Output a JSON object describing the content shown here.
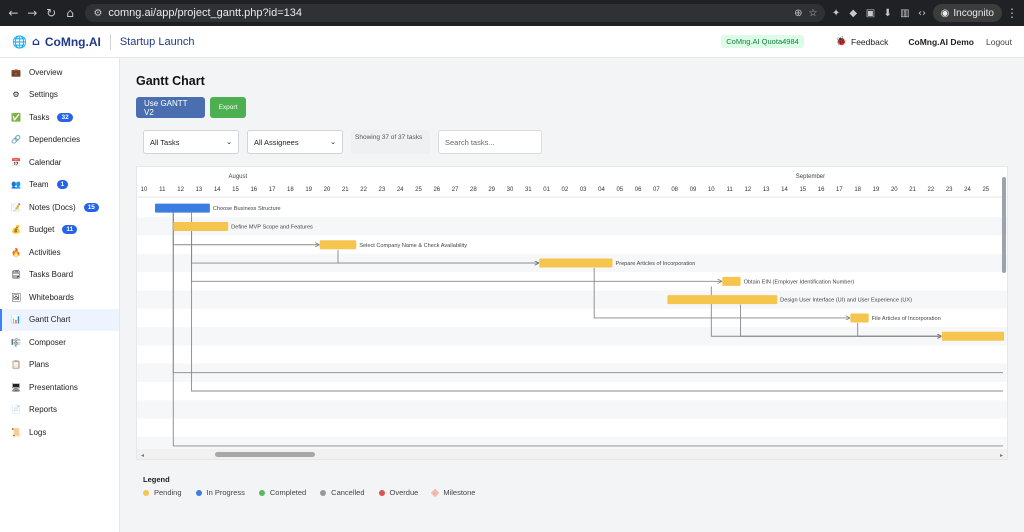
{
  "browser": {
    "url": "comng.ai/app/project_gantt.php?id=134",
    "incognito_label": "Incognito"
  },
  "header": {
    "brand": "CoMng.AI",
    "project": "Startup Launch",
    "quota": "CoMng.AI Quota4984",
    "feedback": "Feedback",
    "user": "CoMng.AI Demo",
    "logout": "Logout"
  },
  "sidebar": {
    "items": [
      {
        "label": "Overview",
        "icon": "briefcase-icon",
        "glyph": "💼"
      },
      {
        "label": "Settings",
        "icon": "gear-icon",
        "glyph": "⚙"
      },
      {
        "label": "Tasks",
        "icon": "check-icon",
        "glyph": "✅",
        "badge": "32"
      },
      {
        "label": "Dependencies",
        "icon": "link-icon",
        "glyph": "🔗"
      },
      {
        "label": "Calendar",
        "icon": "calendar-icon",
        "glyph": "📅"
      },
      {
        "label": "Team",
        "icon": "team-icon",
        "glyph": "👥",
        "badge": "1"
      },
      {
        "label": "Notes (Docs)",
        "icon": "notes-icon",
        "glyph": "📝",
        "badge": "15"
      },
      {
        "label": "Budget",
        "icon": "money-bag-icon",
        "glyph": "💰",
        "badge": "11"
      },
      {
        "label": "Activities",
        "icon": "fire-icon",
        "glyph": "🔥"
      },
      {
        "label": "Tasks Board",
        "icon": "sticky-note-icon",
        "glyph": "🗒"
      },
      {
        "label": "Whiteboards",
        "icon": "board-icon",
        "glyph": "🖼"
      },
      {
        "label": "Gantt Chart",
        "icon": "chart-icon",
        "glyph": "📊",
        "active": true
      },
      {
        "label": "Composer",
        "icon": "composer-icon",
        "glyph": "🎼"
      },
      {
        "label": "Plans",
        "icon": "clipboard-icon",
        "glyph": "📋"
      },
      {
        "label": "Presentations",
        "icon": "presentation-icon",
        "glyph": "🖥"
      },
      {
        "label": "Reports",
        "icon": "report-icon",
        "glyph": "📄"
      },
      {
        "label": "Logs",
        "icon": "scroll-icon",
        "glyph": "📜"
      }
    ]
  },
  "main": {
    "title": "Gantt Chart",
    "use_gantt_label": "Use GANTT V2",
    "export_label": "Export",
    "filter_tasks": "All Tasks",
    "filter_assignees": "All Assignees",
    "showing": "Showing 37 of 37 tasks",
    "search_placeholder": "Search tasks..."
  },
  "gantt": {
    "months": [
      {
        "label": "August",
        "day_index": 5
      },
      {
        "label": "September",
        "day_index": 36
      }
    ],
    "days": [
      "10",
      "11",
      "12",
      "13",
      "14",
      "15",
      "16",
      "17",
      "18",
      "19",
      "20",
      "21",
      "22",
      "23",
      "24",
      "25",
      "26",
      "27",
      "28",
      "29",
      "30",
      "31",
      "01",
      "02",
      "03",
      "04",
      "05",
      "06",
      "07",
      "08",
      "09",
      "10",
      "11",
      "12",
      "13",
      "14",
      "15",
      "16",
      "17",
      "18",
      "19",
      "20",
      "21",
      "22",
      "23",
      "24",
      "25"
    ],
    "tasks": [
      {
        "name": "Choose Business Structure",
        "start": 0.6,
        "end": 3.6,
        "status": "in_progress"
      },
      {
        "name": "Define MVP Scope and Features",
        "start": 1.6,
        "end": 4.6,
        "status": "pending"
      },
      {
        "name": "Select Company Name & Check Availability",
        "start": 9.6,
        "end": 11.6,
        "status": "pending"
      },
      {
        "name": "Prepare Articles of Incorporation",
        "start": 21.6,
        "end": 25.6,
        "status": "pending"
      },
      {
        "name": "Obtain EIN (Employer Identification Number)",
        "start": 31.6,
        "end": 32.6,
        "status": "pending"
      },
      {
        "name": "Design User Interface (UI) and User Experience (UX)",
        "start": 28.6,
        "end": 34.6,
        "status": "pending"
      },
      {
        "name": "File Articles of Incorporation",
        "start": 38.6,
        "end": 39.6,
        "status": "pending"
      },
      {
        "name": "",
        "start": 43.6,
        "end": 47.0,
        "status": "pending"
      }
    ]
  },
  "legend": {
    "title": "Legend",
    "items": [
      {
        "label": "Pending",
        "color": "#f5c54e",
        "shape": "dot"
      },
      {
        "label": "In Progress",
        "color": "#3b7de0",
        "shape": "dot"
      },
      {
        "label": "Completed",
        "color": "#5cb85c",
        "shape": "dot"
      },
      {
        "label": "Cancelled",
        "color": "#999999",
        "shape": "dot"
      },
      {
        "label": "Overdue",
        "color": "#d9534f",
        "shape": "dot"
      },
      {
        "label": "Milestone",
        "color": "#f4b6a8",
        "shape": "diamond"
      }
    ]
  },
  "colors": {
    "pending": "#f5c54e",
    "in_progress": "#3b7de0"
  }
}
